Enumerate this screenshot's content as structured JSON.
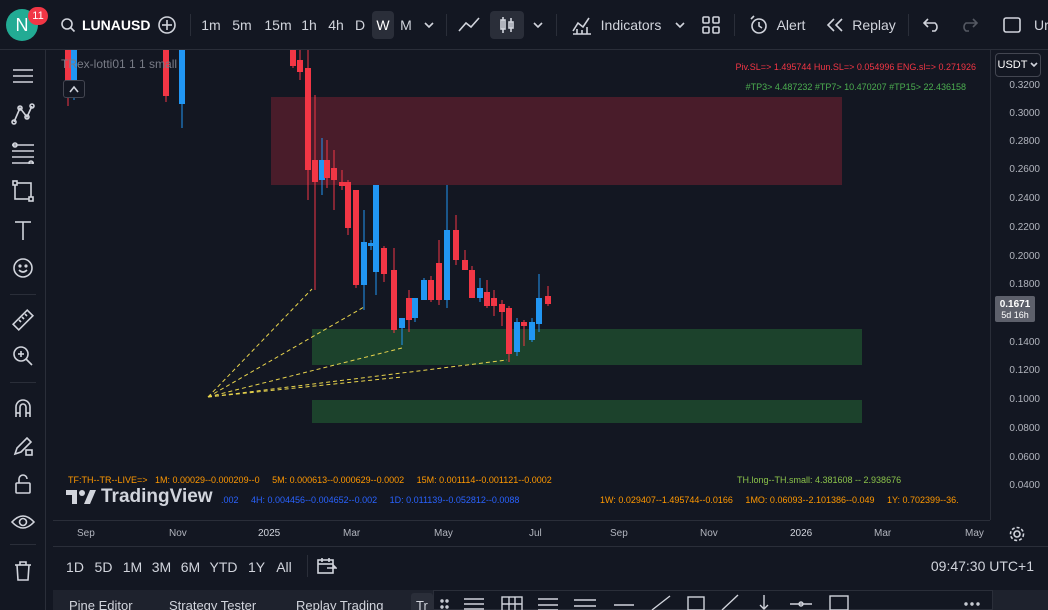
{
  "header": {
    "avatar_letter": "N",
    "notifications": "11",
    "symbol": "LUNAUSD",
    "timeframes": [
      "1m",
      "5m",
      "15m",
      "1h",
      "4h",
      "D",
      "W",
      "M"
    ],
    "active_timeframe": "W",
    "indicators_label": "Indicators",
    "alert_label": "Alert",
    "replay_label": "Replay",
    "truncated_right": "Ur"
  },
  "chart": {
    "indicator_label": "TRex-lotti01 1 1 small",
    "top_info_line1": "Piv.SL=> 1.495744  Hun.SL=> 0.054996  ENG.sl=> 0.271926",
    "top_info_line2": "#TP3> 4.487232  #TP7> 10.470207  #TP15> 22.436158",
    "bottom_line1": "TF:TH--TR--LIVE=>   1M: 0.00029--0.000209--0     5M: 0.000613--0.000629--0.0002     15M: 0.001114--0.001121--0.0002",
    "th_long": "TH.long--TH.small: 4.381608 -- 2.938676",
    "bottom_line2a": ".002     4H: 0.004456--0.004652--0.002     1D: 0.011139--0.052812--0.0088",
    "bottom_line2b": "1W: 0.029407--1.495744--0.0166     1MO: 0.06093--2.101386--0.049     1Y: 0.702399--36.",
    "watermark": "TradingView",
    "currency": "USDT",
    "current_price": "0.1671",
    "countdown": "5d 16h",
    "price_ticks": [
      "0.3200",
      "0.3000",
      "0.2800",
      "0.2600",
      "0.2400",
      "0.2200",
      "0.2000",
      "0.1800",
      "0.1400",
      "0.1200",
      "0.1000",
      "0.0800",
      "0.0600",
      "0.0400"
    ],
    "time_ticks": [
      "Sep",
      "Nov",
      "2025",
      "Mar",
      "May",
      "Jul",
      "Sep",
      "Nov",
      "2026",
      "Mar",
      "May"
    ],
    "colors": {
      "up": "#2196f3",
      "down": "#f23645",
      "supply_zone": "#5c1f2e",
      "demand_zone": "#1f4a2e",
      "fib_lines": "#e8d44d"
    }
  },
  "bottom": {
    "ranges": [
      "1D",
      "5D",
      "1M",
      "3M",
      "6M",
      "YTD",
      "1Y",
      "All"
    ],
    "clock": "09:47:30 UTC+1",
    "tabs": [
      "Pine Editor",
      "Strategy Tester",
      "Replay Trading",
      "Tr"
    ]
  }
}
